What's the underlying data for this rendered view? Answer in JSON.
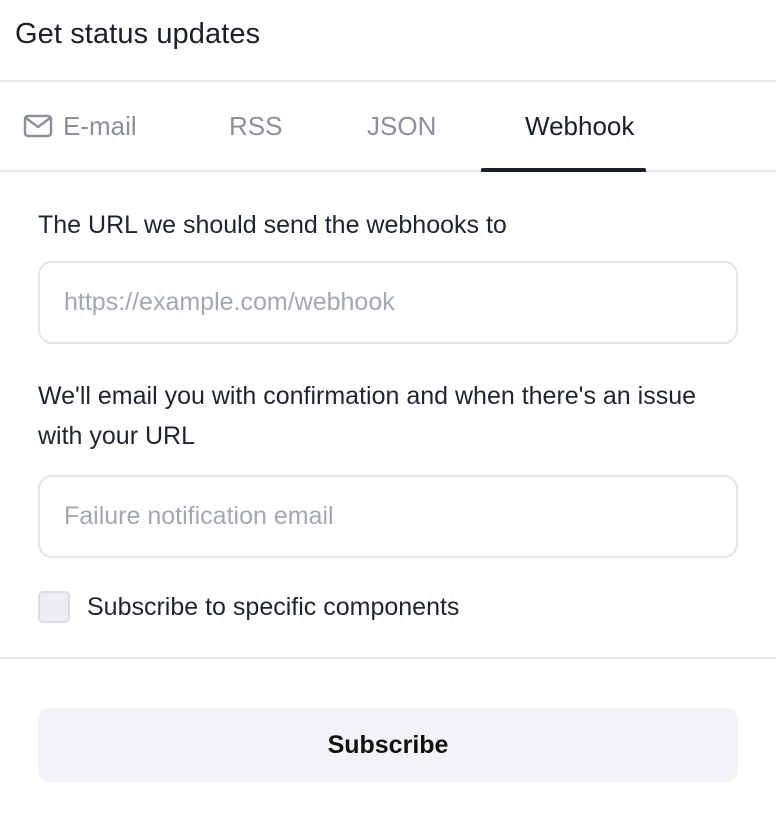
{
  "header": {
    "title": "Get status updates"
  },
  "tabs": [
    {
      "label": "E-mail",
      "icon": "mail-icon",
      "active": false
    },
    {
      "label": "RSS",
      "active": false
    },
    {
      "label": "JSON",
      "active": false
    },
    {
      "label": "Webhook",
      "active": true
    }
  ],
  "webhook_form": {
    "url_label": "The URL we should send the webhooks to",
    "url_placeholder": "https://example.com/webhook",
    "url_value": "",
    "email_label": "We'll email you with confirmation and when there's an issue with your URL",
    "email_placeholder": "Failure notification email",
    "email_value": "",
    "components_checkbox_label": "Subscribe to specific components",
    "components_checked": false
  },
  "actions": {
    "subscribe_label": "Subscribe"
  },
  "colors": {
    "text": "#1f2430",
    "muted_tab": "#8b8f99",
    "active_tab_indicator": "#1b1f2a",
    "border": "#e6e7ea",
    "button_bg": "#f2f3f7",
    "checkbox_bg": "#eceef3"
  }
}
